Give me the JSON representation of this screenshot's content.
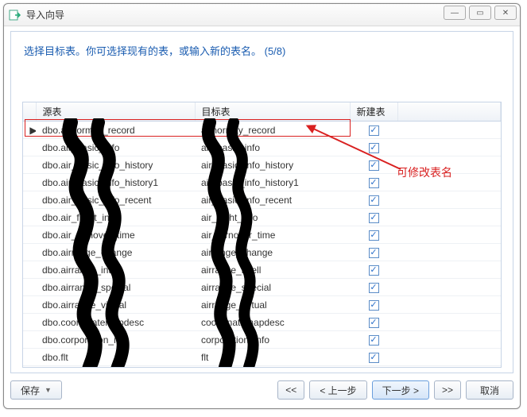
{
  "window": {
    "title": "导入向导"
  },
  "instruction": "选择目标表。你可选择现有的表，或输入新的表名。 (5/8)",
  "columns": {
    "source": "源表",
    "target": "目标表",
    "newTable": "新建表"
  },
  "rows": [
    {
      "source": "dbo.abnormity_record",
      "target": "abnormity_record",
      "new": true,
      "current": true
    },
    {
      "source": "dbo.air_basic_info",
      "target": "air_basic_info",
      "new": true,
      "current": false
    },
    {
      "source": "dbo.air_basic_info_history",
      "target": "air_basic_info_history",
      "new": true,
      "current": false
    },
    {
      "source": "dbo.air_basic_info_history1",
      "target": "air_basic_info_history1",
      "new": true,
      "current": false
    },
    {
      "source": "dbo.air_basic_info_recent",
      "target": "air_basic_info_recent",
      "new": true,
      "current": false
    },
    {
      "source": "dbo.air_flight_info",
      "target": "air_flight_info",
      "new": true,
      "current": false
    },
    {
      "source": "dbo.air_turnover_time",
      "target": "air_turnover_time",
      "new": true,
      "current": false
    },
    {
      "source": "dbo.airrange_change",
      "target": "airrange_change",
      "new": true,
      "current": false
    },
    {
      "source": "dbo.airrange_intell",
      "target": "airrange_intell",
      "new": true,
      "current": false
    },
    {
      "source": "dbo.airrange_special",
      "target": "airrange_special",
      "new": true,
      "current": false
    },
    {
      "source": "dbo.airrange_virtual",
      "target": "airrange_virtual",
      "new": true,
      "current": false
    },
    {
      "source": "dbo.coordinatemapdesc",
      "target": "coordinatemapdesc",
      "new": true,
      "current": false
    },
    {
      "source": "dbo.corporation_info",
      "target": "corporation_info",
      "new": true,
      "current": false
    },
    {
      "source": "dbo.flt",
      "target": "flt",
      "new": true,
      "current": false
    }
  ],
  "annotation": "可修改表名",
  "buttons": {
    "save": "保存",
    "first": "<<",
    "prev": "< 上一步",
    "next": "下一步 >",
    "last": ">>",
    "cancel": "取消"
  }
}
